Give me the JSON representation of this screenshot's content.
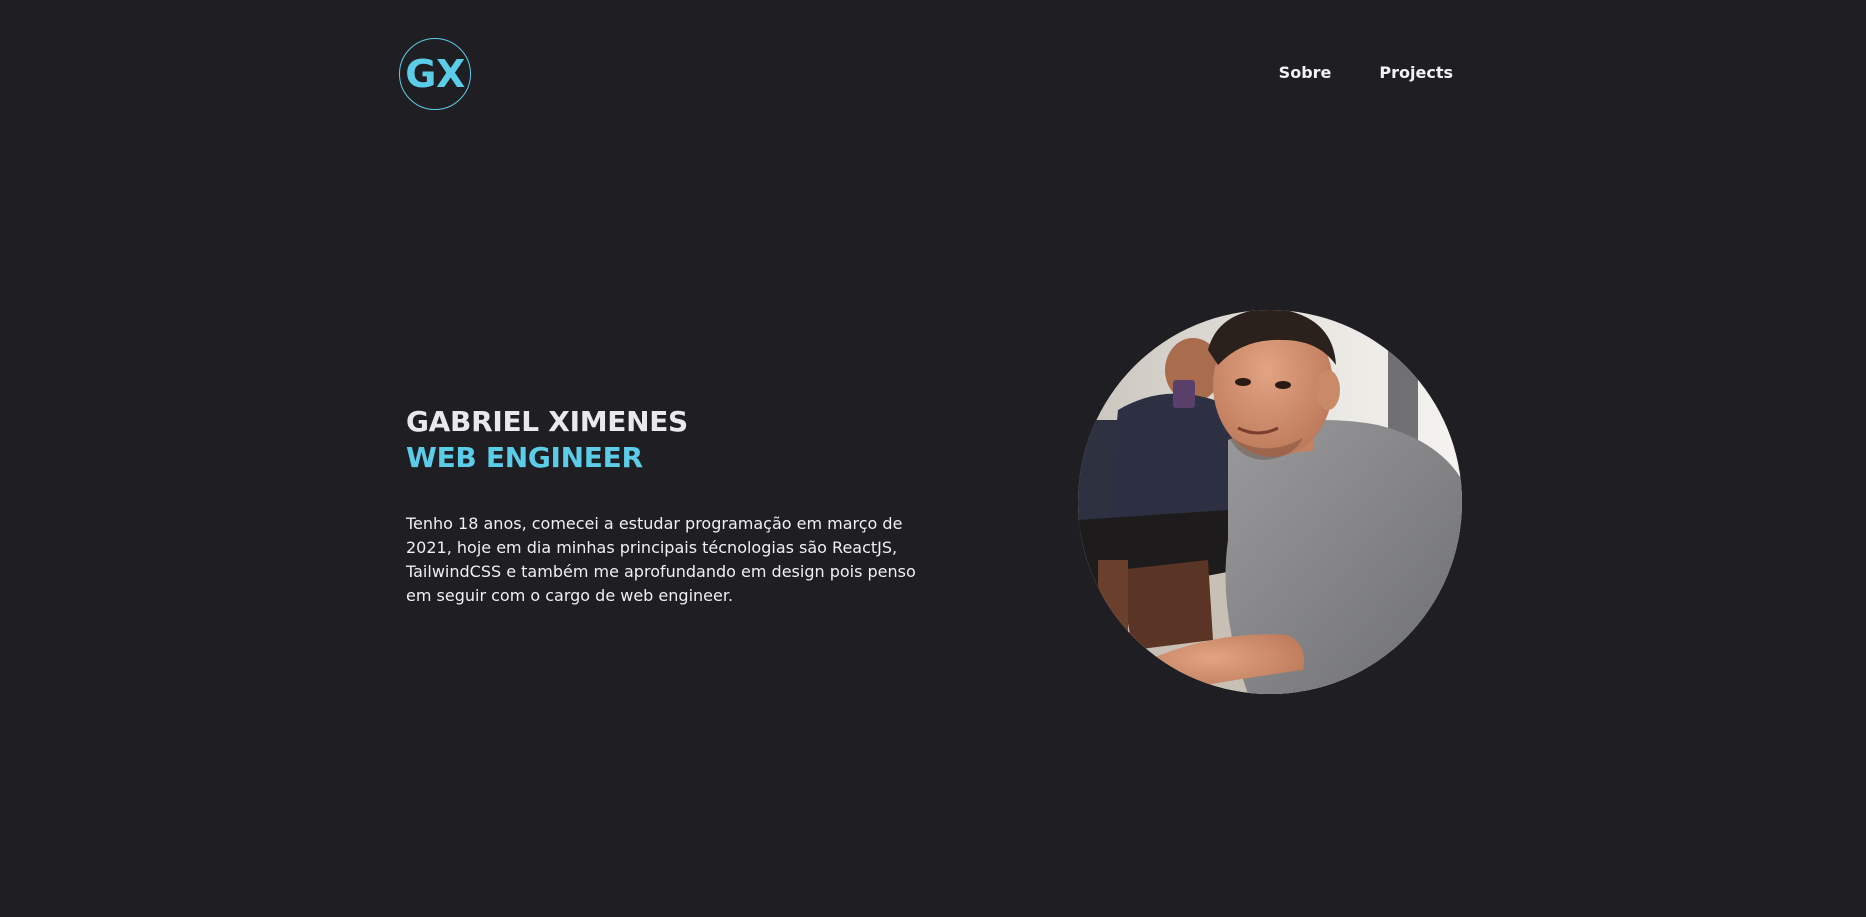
{
  "header": {
    "logo_text": "GX",
    "nav": [
      {
        "label": "Sobre"
      },
      {
        "label": "Projects"
      }
    ]
  },
  "hero": {
    "name": "GABRIEL XIMENES",
    "role": "WEB ENGINEER",
    "bio": "Tenho 18 anos, comecei a estudar programação em março de 2021, hoje em dia minhas principais técnologias são ReactJS, TailwindCSS e também me aprofundando em design pois penso em seguir com o cargo de web engineer."
  },
  "colors": {
    "background": "#1f1e23",
    "accent": "#5ccde8",
    "text": "#e9e9eb"
  },
  "icons": {
    "profile": "profile-photo"
  }
}
